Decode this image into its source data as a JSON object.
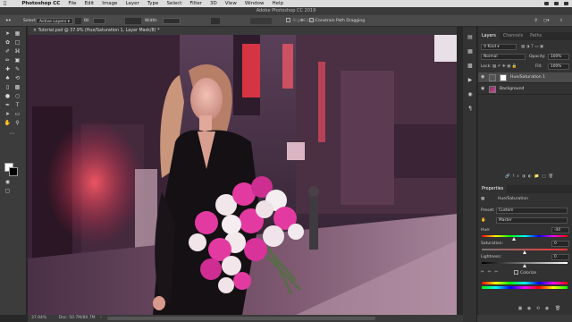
{
  "menubar": {
    "app_name": "Photoshop CC",
    "items": [
      "File",
      "Edit",
      "Image",
      "Layer",
      "Type",
      "Select",
      "Filter",
      "3D",
      "View",
      "Window",
      "Help"
    ]
  },
  "titlebar": {
    "title": "Adobe Photoshop CC 2019"
  },
  "options": {
    "select_label": "Select:",
    "select_value": "Active Layers",
    "mode_value": "Bll",
    "weight_label": "Width:",
    "align_label": "Align Edges",
    "constrain_label": "Constrain Path Dragging"
  },
  "document": {
    "tab_title": "Tutorial.psd @ 37.9% (Hue/Saturation 1, Layer Mask/8) *",
    "zoom": "37.94%",
    "doc_info": "Doc: 50.7M/80.7M"
  },
  "layers_panel": {
    "tabs": [
      "Layers",
      "Channels",
      "Paths"
    ],
    "kind_label": "Kind",
    "blend_mode": "Normal",
    "opacity_label": "Opacity:",
    "opacity_value": "100%",
    "lock_label": "Lock:",
    "fill_label": "Fill:",
    "fill_value": "100%",
    "layers": [
      {
        "name": "Hue/Saturation 1"
      },
      {
        "name": "Background"
      }
    ]
  },
  "properties_panel": {
    "tab": "Properties",
    "adjustment_title": "Hue/Saturation",
    "preset_label": "Preset:",
    "preset_value": "Custom",
    "channel_value": "Master",
    "hue_label": "Hue:",
    "hue_value": "-44",
    "saturation_label": "Saturation:",
    "saturation_value": "0",
    "lightness_label": "Lightness:",
    "lightness_value": "0",
    "colorize_label": "Colorize"
  },
  "colors": {
    "ui_dark": "#282828",
    "panel": "#323232",
    "accent_pink": "#e23aa0",
    "neon_red": "#ff3b4a"
  }
}
